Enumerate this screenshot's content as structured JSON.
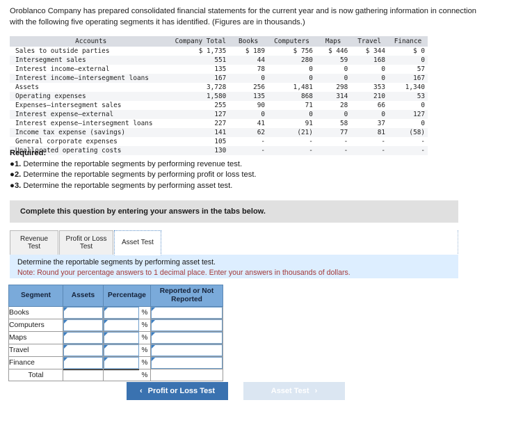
{
  "intro": {
    "text": "Oroblanco Company has prepared consolidated financial statements for the current year and is now gathering information in connection with the following five operating segments it has identified. (Figures are in thousands.)"
  },
  "financial_table": {
    "columns": [
      "Accounts",
      "Company Total",
      "Books",
      "Computers",
      "Maps",
      "Travel",
      "Finance"
    ],
    "rows": [
      {
        "label": "Sales to outside parties",
        "values": [
          "$ 1,735",
          "$ 189",
          "$ 756",
          "$ 446",
          "$ 344",
          "$ 0"
        ]
      },
      {
        "label": "Intersegment sales",
        "values": [
          "551",
          "44",
          "280",
          "59",
          "168",
          "0"
        ]
      },
      {
        "label": "Interest income–external",
        "values": [
          "135",
          "78",
          "0",
          "0",
          "0",
          "57"
        ]
      },
      {
        "label": "Interest income–intersegment loans",
        "values": [
          "167",
          "0",
          "0",
          "0",
          "0",
          "167"
        ]
      },
      {
        "label": "Assets",
        "values": [
          "3,728",
          "256",
          "1,481",
          "298",
          "353",
          "1,340"
        ]
      },
      {
        "label": "Operating expenses",
        "values": [
          "1,580",
          "135",
          "868",
          "314",
          "210",
          "53"
        ]
      },
      {
        "label": "Expenses–intersegment sales",
        "values": [
          "255",
          "90",
          "71",
          "28",
          "66",
          "0"
        ]
      },
      {
        "label": "Interest expense–external",
        "values": [
          "127",
          "0",
          "0",
          "0",
          "0",
          "127"
        ]
      },
      {
        "label": "Interest expense–intersegment loans",
        "values": [
          "227",
          "41",
          "91",
          "58",
          "37",
          "0"
        ]
      },
      {
        "label": "Income tax expense (savings)",
        "values": [
          "141",
          "62",
          "(21)",
          "77",
          "81",
          "(58)"
        ]
      },
      {
        "label": "General corporate expenses",
        "values": [
          "105",
          "-",
          "-",
          "-",
          "-",
          "-"
        ]
      },
      {
        "label": "Unallocated operating costs",
        "values": [
          "130",
          "-",
          "-",
          "-",
          "-",
          "-"
        ]
      }
    ]
  },
  "required": {
    "heading": "Required:",
    "bullet": "●",
    "items": [
      {
        "num": "1.",
        "text": "Determine the reportable segments by performing revenue test."
      },
      {
        "num": "2.",
        "text": "Determine the reportable segments by performing profit or loss test."
      },
      {
        "num": "3.",
        "text": "Determine the reportable segments by performing asset test."
      }
    ]
  },
  "complete_bar": {
    "text": "Complete this question by entering your answers in the tabs below."
  },
  "tabs": [
    {
      "label": "Revenue Test",
      "active": false
    },
    {
      "label": "Profit or Loss Test",
      "active": false
    },
    {
      "label": "Asset Test",
      "active": true
    }
  ],
  "instruction": {
    "line1": "Determine the reportable segments by performing asset test.",
    "line2": "Note: Round your percentage answers to 1 decimal place. Enter your answers in thousands of dollars."
  },
  "answer_table": {
    "headers": [
      "Segment",
      "Assets",
      "Percentage",
      "Reported or Not Reported"
    ],
    "percent_sign": "%",
    "rows": [
      {
        "segment": "Books",
        "assets": "",
        "percentage": "",
        "reported": ""
      },
      {
        "segment": "Computers",
        "assets": "",
        "percentage": "",
        "reported": ""
      },
      {
        "segment": "Maps",
        "assets": "",
        "percentage": "",
        "reported": ""
      },
      {
        "segment": "Travel",
        "assets": "",
        "percentage": "",
        "reported": ""
      },
      {
        "segment": "Finance",
        "assets": "",
        "percentage": "",
        "reported": ""
      }
    ],
    "total_row": {
      "segment": "Total",
      "assets": "",
      "percentage": "",
      "reported": ""
    }
  },
  "nav": {
    "prev_label": "Profit or Loss Test",
    "prev_chevron": "‹",
    "next_label": "Asset Test",
    "next_chevron": "›"
  },
  "colors": {
    "header_blue": "#7aaada",
    "fin_header": "#dadde3",
    "instr_blue": "#ddeeff",
    "complete_gray": "#e0e0e0",
    "btn_active": "#3a72b0",
    "btn_disabled": "#dbe6f2",
    "note_red": "#a33a3a"
  }
}
